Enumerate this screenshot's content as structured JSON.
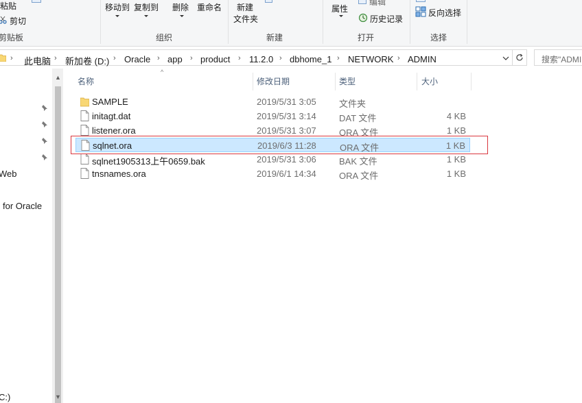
{
  "ribbon": {
    "paste": "粘贴",
    "cut": "剪切",
    "clipboard_label": "剪贴板",
    "move_to": "移动到",
    "copy_to": "复制到",
    "delete": "删除",
    "rename": "重命名",
    "organize_label": "组织",
    "new_folder_line1": "新建",
    "new_folder_line2": "文件夹",
    "new_label": "新建",
    "properties": "属性",
    "edit": "编辑",
    "history": "历史记录",
    "open_label": "打开",
    "invert_selection": "反向选择",
    "select_label": "选择"
  },
  "address": {
    "crumbs": [
      "此电脑",
      "新加卷 (D:)",
      "Oracle",
      "app",
      "product",
      "11.2.0",
      "dbhome_1",
      "NETWORK",
      "ADMIN"
    ],
    "search_placeholder": "搜索\"ADMIN\""
  },
  "nav": {
    "items": [
      "Web",
      "for Oracle",
      "C:)"
    ]
  },
  "columns": {
    "name": "名称",
    "modified": "修改日期",
    "type": "类型",
    "size": "大小"
  },
  "files": [
    {
      "name": "SAMPLE",
      "modified": "2019/5/31 3:05",
      "type": "文件夹",
      "size": "",
      "kind": "folder"
    },
    {
      "name": "initagt.dat",
      "modified": "2019/5/31 3:14",
      "type": "DAT 文件",
      "size": "4 KB",
      "kind": "file"
    },
    {
      "name": "listener.ora",
      "modified": "2019/5/31 3:07",
      "type": "ORA 文件",
      "size": "1 KB",
      "kind": "file"
    },
    {
      "name": "sqlnet.ora",
      "modified": "2019/6/3 11:28",
      "type": "ORA 文件",
      "size": "1 KB",
      "kind": "file",
      "selected": true
    },
    {
      "name": "sqlnet1905313上午0659.bak",
      "modified": "2019/5/31 3:06",
      "type": "BAK 文件",
      "size": "1 KB",
      "kind": "file"
    },
    {
      "name": "tnsnames.ora",
      "modified": "2019/6/1 14:34",
      "type": "ORA 文件",
      "size": "1 KB",
      "kind": "file"
    }
  ],
  "colors": {
    "selection_bg": "#cce8ff",
    "selection_border": "#99d1ff",
    "annotation_red": "#d9363e",
    "folder_yellow": "#f8d775"
  }
}
